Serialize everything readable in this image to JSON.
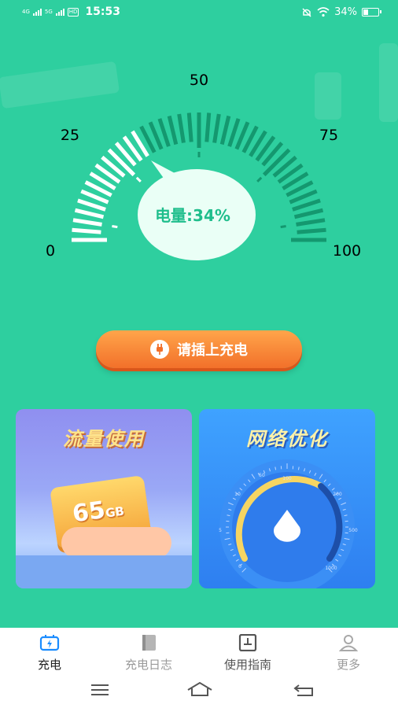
{
  "status_bar": {
    "network1": "4G",
    "network2": "5G",
    "hd": "HD",
    "time": "15:53",
    "battery_percent": "34%",
    "battery_level": 0.34
  },
  "gauge": {
    "labels": [
      "0",
      "25",
      "50",
      "75",
      "100"
    ],
    "battery_text": "电量:34%",
    "level_percent": 34
  },
  "charge_button": {
    "label": "请插上充电"
  },
  "cards": [
    {
      "title": "流量使用",
      "ticket_value": "65",
      "ticket_unit": "GB"
    },
    {
      "title": "网络优化",
      "speed_labels": [
        "0",
        "5",
        "10",
        "50",
        "100",
        "200",
        "500",
        "1000"
      ]
    }
  ],
  "bottom_nav": [
    {
      "label": "充电",
      "icon": "charge-icon",
      "active": true
    },
    {
      "label": "充电日志",
      "icon": "log-book-icon",
      "active": false
    },
    {
      "label": "使用指南",
      "icon": "guide-icon",
      "active": false
    },
    {
      "label": "更多",
      "icon": "person-icon",
      "active": false
    }
  ],
  "colors": {
    "background": "#2ecf9f",
    "accent_orange": "#f2702a",
    "active_nav": "#1a8cff"
  }
}
